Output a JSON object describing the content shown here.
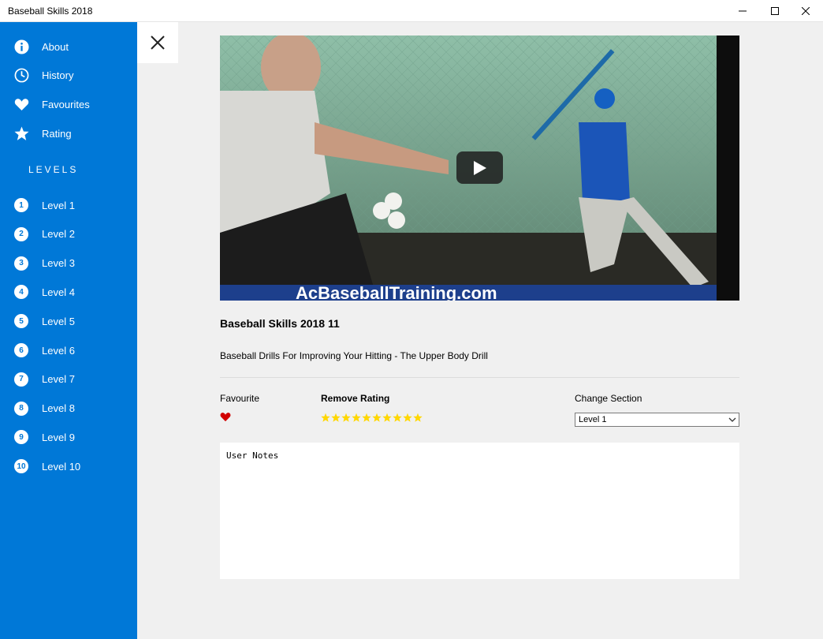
{
  "window": {
    "title": "Baseball Skills 2018"
  },
  "sidebar": {
    "items": [
      {
        "label": "About",
        "icon": "info-icon"
      },
      {
        "label": "History",
        "icon": "clock-icon"
      },
      {
        "label": "Favourites",
        "icon": "heart-icon"
      },
      {
        "label": "Rating",
        "icon": "star-icon"
      }
    ],
    "levels_heading": "LEVELS",
    "levels": [
      {
        "num": "1",
        "label": "Level 1"
      },
      {
        "num": "2",
        "label": "Level 2"
      },
      {
        "num": "3",
        "label": "Level 3"
      },
      {
        "num": "4",
        "label": "Level 4"
      },
      {
        "num": "5",
        "label": "Level 5"
      },
      {
        "num": "6",
        "label": "Level 6"
      },
      {
        "num": "7",
        "label": "Level 7"
      },
      {
        "num": "8",
        "label": "Level 8"
      },
      {
        "num": "9",
        "label": "Level 9"
      },
      {
        "num": "10",
        "label": "Level 10"
      }
    ]
  },
  "video": {
    "title": "Baseball Skills 2018 11",
    "description": "Baseball Drills For Improving Your Hitting - The Upper Body Drill",
    "watermark": "AcBaseballTraining.com"
  },
  "details": {
    "favourite_label": "Favourite",
    "rating_label": "Remove Rating",
    "rating_value": 10,
    "rating_max": 10,
    "section_label": "Change Section",
    "section_value": "Level 1"
  },
  "notes": {
    "placeholder": "User Notes"
  },
  "colors": {
    "accent": "#0078d7",
    "heart": "#e81123",
    "star": "#ffd700"
  }
}
